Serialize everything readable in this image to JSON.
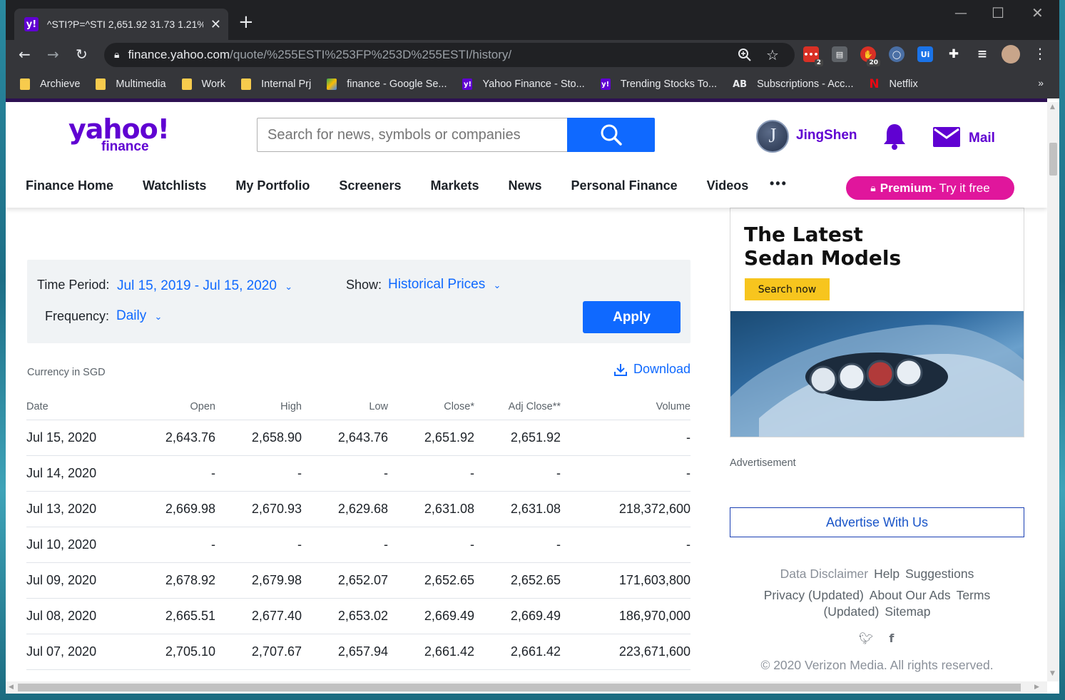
{
  "browser": {
    "tab_title": "^STI?P=^STI 2,651.92 31.73 1.21%",
    "url_host": "finance.yahoo.com",
    "url_path": "/quote/%255ESTI%253FP%253D%255ESTI/history/",
    "extension_badges": [
      "2",
      "20"
    ],
    "bookmarks": [
      {
        "label": "Archieve",
        "icon": "folder-icon"
      },
      {
        "label": "Multimedia",
        "icon": "folder-icon"
      },
      {
        "label": "Work",
        "icon": "folder-icon"
      },
      {
        "label": "Internal Prj",
        "icon": "folder-icon"
      },
      {
        "label": "finance - Google Se...",
        "icon": "google-sheets-icon"
      },
      {
        "label": "Yahoo Finance - Sto...",
        "icon": "yahoo-icon"
      },
      {
        "label": "Trending Stocks To...",
        "icon": "yahoo-icon"
      },
      {
        "label": "Subscriptions - Acc...",
        "icon": "ab-icon"
      },
      {
        "label": "Netflix",
        "icon": "netflix-icon"
      }
    ]
  },
  "header": {
    "logo_main": "yahoo!",
    "logo_sub": "finance",
    "search_placeholder": "Search for news, symbols or companies",
    "user_initial": "J",
    "user_name": "JingShen",
    "mail_label": "Mail",
    "nav": [
      "Finance Home",
      "Watchlists",
      "My Portfolio",
      "Screeners",
      "Markets",
      "News",
      "Personal Finance",
      "Videos"
    ],
    "nav_more": "•••",
    "premium_bold": "Premium",
    "premium_rest": " - Try it free"
  },
  "filters": {
    "time_period_label": "Time Period:",
    "time_period_value": "Jul 15, 2019 - Jul 15, 2020",
    "show_label": "Show:",
    "show_value": "Historical Prices",
    "frequency_label": "Frequency:",
    "frequency_value": "Daily",
    "apply_label": "Apply"
  },
  "currency_note": "Currency in SGD",
  "download_label": "Download",
  "table": {
    "headers": [
      "Date",
      "Open",
      "High",
      "Low",
      "Close*",
      "Adj Close**",
      "Volume"
    ],
    "rows": [
      [
        "Jul 15, 2020",
        "2,643.76",
        "2,658.90",
        "2,643.76",
        "2,651.92",
        "2,651.92",
        "-"
      ],
      [
        "Jul 14, 2020",
        "-",
        "-",
        "-",
        "-",
        "-",
        "-"
      ],
      [
        "Jul 13, 2020",
        "2,669.98",
        "2,670.93",
        "2,629.68",
        "2,631.08",
        "2,631.08",
        "218,372,600"
      ],
      [
        "Jul 10, 2020",
        "-",
        "-",
        "-",
        "-",
        "-",
        "-"
      ],
      [
        "Jul 09, 2020",
        "2,678.92",
        "2,679.98",
        "2,652.07",
        "2,652.65",
        "2,652.65",
        "171,603,800"
      ],
      [
        "Jul 08, 2020",
        "2,665.51",
        "2,677.40",
        "2,653.02",
        "2,669.49",
        "2,669.49",
        "186,970,000"
      ],
      [
        "Jul 07, 2020",
        "2,705.10",
        "2,707.67",
        "2,657.94",
        "2,661.42",
        "2,661.42",
        "223,671,600"
      ]
    ]
  },
  "sidebar": {
    "ad_title_line1": "The Latest",
    "ad_title_line2": "Sedan Models",
    "ad_button": "Search now",
    "ad_label": "Advertisement",
    "advertise_label": "Advertise With Us",
    "footer_row1": [
      "Data Disclaimer",
      "Help",
      "Suggestions"
    ],
    "footer_row2": [
      "Privacy (Updated)",
      "About Our Ads",
      "Terms"
    ],
    "footer_row3": [
      "(Updated)",
      "Sitemap"
    ],
    "copyright": "© 2020 Verizon Media. All rights reserved."
  },
  "colors": {
    "brand_purple": "#6001d2",
    "accent_blue": "#0f69ff",
    "premium_pink": "#e0169c"
  }
}
